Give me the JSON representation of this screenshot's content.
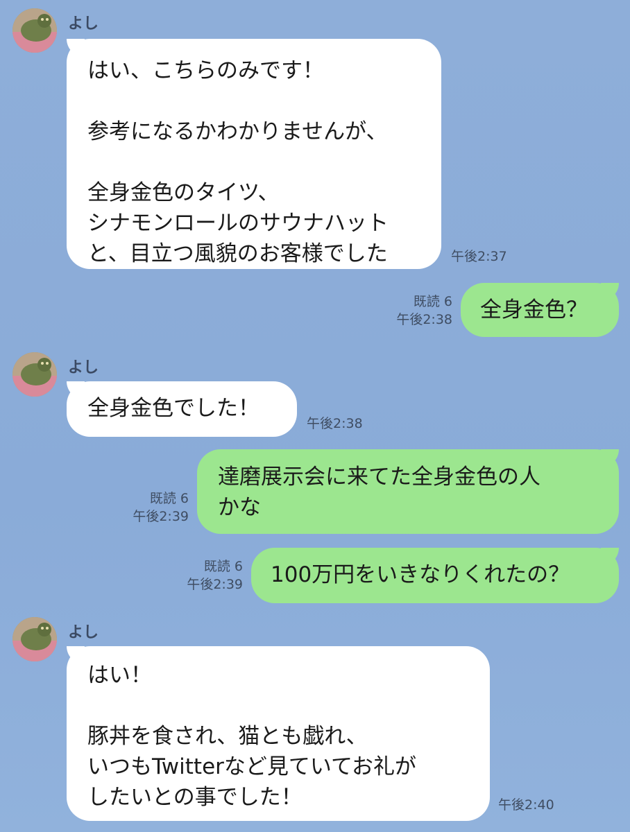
{
  "messages": [
    {
      "sender": "よし",
      "text": "はい、こちらのみです！\n\n参考になるかわかりませんが、\n\n全身金色のタイツ、\nシナモンロールのサウナハット\nと、目立つ風貌のお客様でした",
      "time": "午後2:37"
    },
    {
      "read": "既読 6",
      "text": "全身金色？",
      "time": "午後2:38"
    },
    {
      "sender": "よし",
      "text": "全身金色でした！",
      "time": "午後2:38"
    },
    {
      "read": "既読 6",
      "text": "達磨展示会に来てた全身金色の人\nかな",
      "time": "午後2:39"
    },
    {
      "read": "既読 6",
      "text": "100万円をいきなりくれたの？",
      "time": "午後2:39"
    },
    {
      "sender": "よし",
      "text": "はい！\n\n豚丼を食され、猫とも戯れ、\nいつもTwitterなど見ていてお礼が\nしたいとの事でした！",
      "time": "午後2:40"
    }
  ]
}
